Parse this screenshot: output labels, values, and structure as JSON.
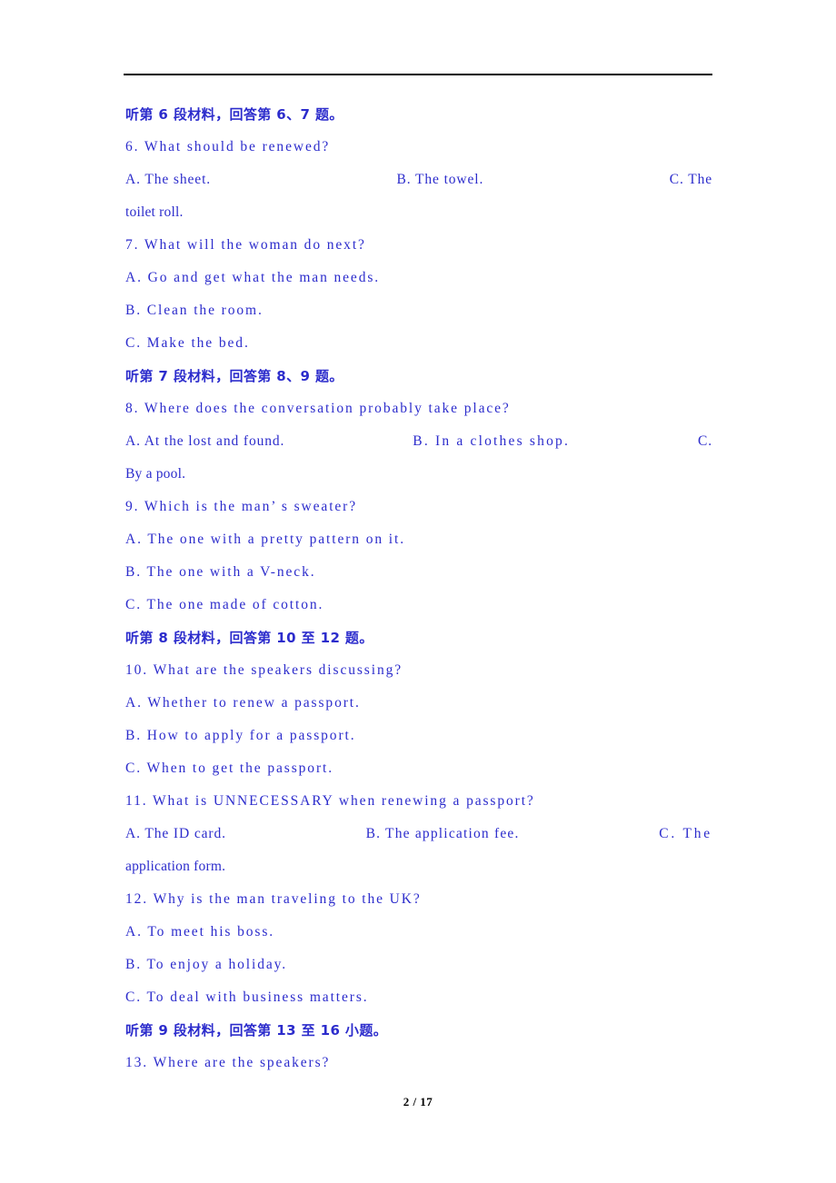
{
  "document": {
    "page_label": "2 / 17",
    "text_color": "#2c2ccc",
    "rule_color": "#000000",
    "footer_color": "#000000"
  },
  "blocks": [
    {
      "kind": "cn_heading",
      "text": "听第 6 段材料，回答第 6、7 题。"
    },
    {
      "kind": "question",
      "text": "6. What should be renewed?"
    },
    {
      "kind": "spread",
      "a": "A. The sheet.",
      "b": "B. The towel.",
      "c": "C.    The"
    },
    {
      "kind": "wrap",
      "text": "toilet roll."
    },
    {
      "kind": "question",
      "text": "7. What will the woman do next?"
    },
    {
      "kind": "option",
      "text": "A. Go and get what the man needs."
    },
    {
      "kind": "option",
      "text": "B. Clean the room."
    },
    {
      "kind": "option",
      "text": "C. Make the bed."
    },
    {
      "kind": "cn_heading",
      "text": "听第 7 段材料，回答第 8、9 题。"
    },
    {
      "kind": "question",
      "text": "8. Where does the conversation probably take place?"
    },
    {
      "kind": "spread",
      "a": "A. At the lost and found.",
      "b": "B. In a clothes shop.",
      "c": "C."
    },
    {
      "kind": "wrap",
      "text": "By a pool."
    },
    {
      "kind": "question",
      "text": "9. Which is the man’ s sweater?"
    },
    {
      "kind": "option",
      "text": "A. The one with a pretty pattern on it."
    },
    {
      "kind": "option",
      "text": "B. The one with a V-neck."
    },
    {
      "kind": "option",
      "text": "C. The one made of cotton."
    },
    {
      "kind": "cn_heading",
      "text": "听第 8 段材料，回答第 10 至 12 题。"
    },
    {
      "kind": "question",
      "text": "10. What are the speakers discussing?"
    },
    {
      "kind": "option",
      "text": "A. Whether to renew a passport."
    },
    {
      "kind": "option",
      "text": "B. How to apply for a passport."
    },
    {
      "kind": "option",
      "text": "C. When to get the passport."
    },
    {
      "kind": "question",
      "text": "11. What is UNNECESSARY when renewing a passport?"
    },
    {
      "kind": "spread",
      "a": "A. The ID card.",
      "b": "B. The application fee.",
      "c": "C.     The"
    },
    {
      "kind": "wrap",
      "text": "application form."
    },
    {
      "kind": "question",
      "text": "12. Why is the man traveling to the UK?"
    },
    {
      "kind": "option",
      "text": "A. To meet his boss."
    },
    {
      "kind": "option",
      "text": "B. To enjoy a holiday."
    },
    {
      "kind": "option",
      "text": "C. To deal with business matters."
    },
    {
      "kind": "cn_heading",
      "text": "听第 9 段材料，回答第 13 至 16 小题。"
    },
    {
      "kind": "question",
      "text": "13. Where are the speakers?"
    }
  ]
}
